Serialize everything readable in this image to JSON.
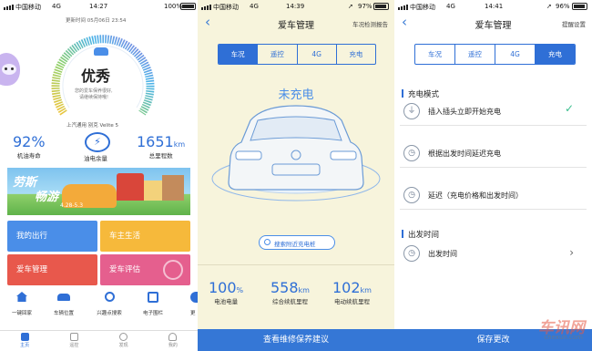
{
  "status1": {
    "carrier": "中国移动",
    "network": "4G",
    "time": "14:27",
    "battery": "100%"
  },
  "status2": {
    "carrier": "中国移动",
    "network": "4G",
    "time": "14:39",
    "battery": "97%"
  },
  "status3": {
    "carrier": "中国移动",
    "network": "4G",
    "time": "14:41",
    "battery": "96%"
  },
  "home": {
    "update_time": "更新时间 05月06日 23:54",
    "score_label": "优秀",
    "score_desc_line1": "您的爱车保养很好,",
    "score_desc_line2": "请继续保持哦!",
    "car_name": "上汽通用 别克 Velite 5",
    "oil_life_value": "92%",
    "oil_life_label": "机油寿命",
    "fuel_label": "油电余量",
    "mileage_value": "1651",
    "mileage_unit": "km",
    "mileage_label": "总里程数",
    "banner_text_line1": "劳斯",
    "banner_text_line2": "畅游",
    "banner_dates": "4.28-5.3",
    "tiles": [
      "我的出行",
      "车主生活",
      "爱车管理",
      "爱车评估"
    ],
    "quick_actions": [
      "一键回家",
      "车辆位置",
      "兴趣点搜索",
      "电子围栏",
      "更"
    ],
    "tabs": [
      "主页",
      "遥控",
      "发现",
      "我的"
    ]
  },
  "car": {
    "title": "爱车管理",
    "report_link": "车况检测报告",
    "segments": [
      "车况",
      "遥控",
      "4G",
      "充电"
    ],
    "charge_state": "未充电",
    "search_chargers": "搜索附近充电桩",
    "battery_value": "100",
    "battery_unit": "%",
    "battery_label": "电池电量",
    "range_total_value": "558",
    "range_total_unit": "km",
    "range_total_label": "综合续航里程",
    "range_ev_value": "102",
    "range_ev_unit": "km",
    "range_ev_label": "电动续航里程",
    "bottom_button": "查看维修保养建议"
  },
  "charge": {
    "title": "爱车管理",
    "reminder_link": "提醒设置",
    "segments": [
      "车况",
      "遥控",
      "4G",
      "充电"
    ],
    "mode_section": "充电模式",
    "mode_options": [
      "插入插头立即开始充电",
      "根据出发时间延迟充电",
      "延迟（充电价格和出发时间）"
    ],
    "depart_section": "出发时间",
    "depart_item": "出发时间",
    "save_button": "保存更改"
  },
  "watermark": {
    "logo": "车讯网",
    "url": "chexun.com"
  },
  "colors": {
    "accent": "#2f6fd6",
    "panel2_bg": "#f7f4dc",
    "tile_blue": "#4a8ee8",
    "tile_yellow": "#f6b93b",
    "tile_red": "#e8584c",
    "tile_pink": "#e55f8e"
  },
  "icons": [
    "robot-mascot-icon",
    "car-icon",
    "battery-charge-icon",
    "search-icon",
    "home-icon",
    "location-icon",
    "fence-icon",
    "check-icon",
    "plug-icon",
    "clock-icon",
    "chevron-right-icon",
    "back-chevron-icon"
  ]
}
